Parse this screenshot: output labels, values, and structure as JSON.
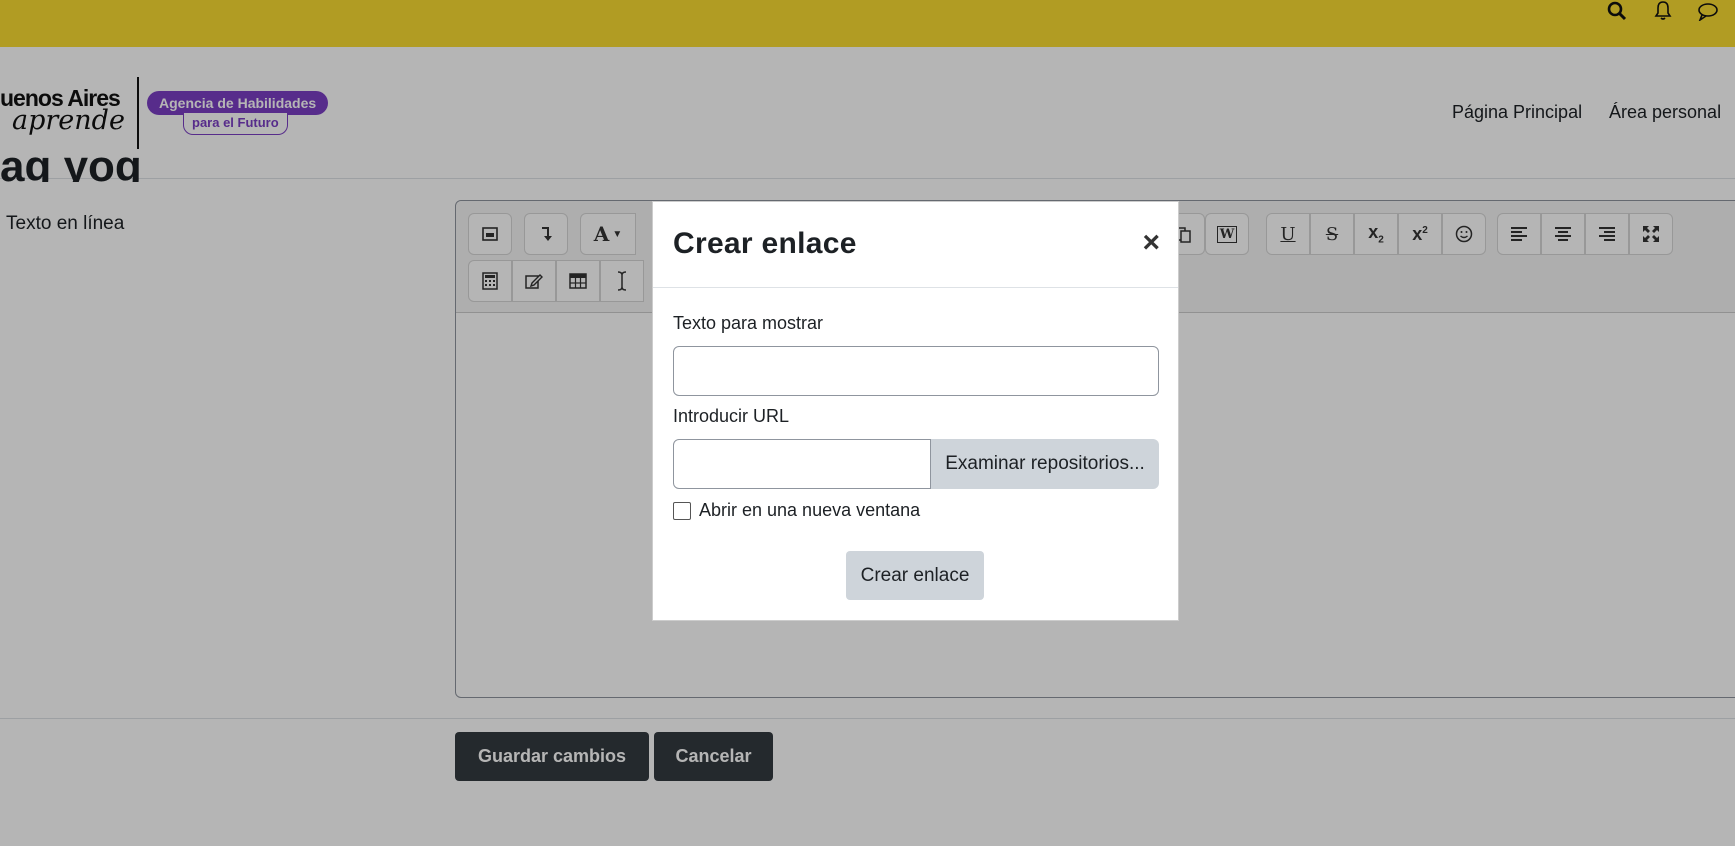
{
  "header": {
    "logo_line1": "uenos Aires",
    "logo_line2": "aprende",
    "badge_line1": "Agencia de Habilidades",
    "badge_line2": "para el Futuro",
    "nav": [
      "Página Principal",
      "Área personal"
    ]
  },
  "topbar": {
    "icons": [
      "search-icon",
      "bell-icon",
      "chat-icon"
    ]
  },
  "page": {
    "field_label": "Texto en línea",
    "save_label": "Guardar cambios",
    "cancel_label": "Cancelar"
  },
  "editor": {
    "toolbar_row1": [
      "toolbar-toggle-icon",
      "insert-icon",
      "font-icon",
      "paste-icon",
      "word-paste-icon",
      "underline-icon",
      "strikethrough-icon",
      "subscript-icon",
      "superscript-icon",
      "emoticon-icon",
      "align-left-icon",
      "align-center-icon",
      "align-right-icon",
      "fullscreen-icon"
    ],
    "toolbar_row2": [
      "calculator-icon",
      "edit-icon",
      "table-icon",
      "cursor-icon"
    ]
  },
  "modal": {
    "title": "Crear enlace",
    "close": "×",
    "text_label": "Texto para mostrar",
    "text_value": "",
    "url_label": "Introducir URL",
    "url_value": "",
    "browse_label": "Examinar repositorios...",
    "new_window_label": "Abrir en una nueva ventana",
    "new_window_checked": false,
    "submit_label": "Crear enlace"
  }
}
